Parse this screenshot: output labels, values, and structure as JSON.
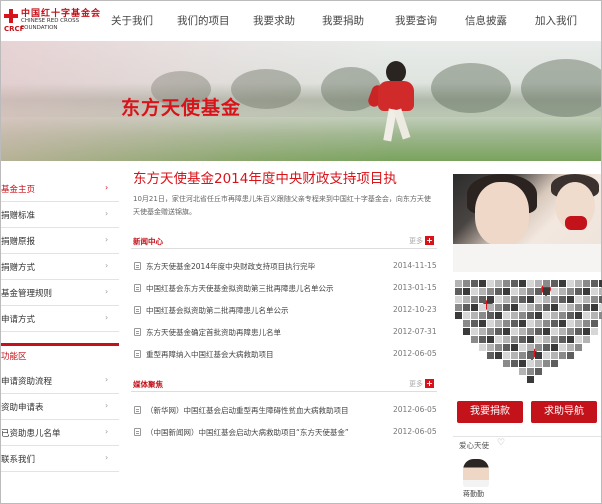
{
  "logo": {
    "cn": "中国红十字基金会",
    "en_line1": "CHINESE RED CROSS",
    "en_line2": "FOUNDATION",
    "abbr": "CRCF"
  },
  "nav": [
    "关于我们",
    "我们的项目",
    "我要求助",
    "我要捐助",
    "我要查询",
    "信息披露",
    "加入我们"
  ],
  "banner": {
    "title": "东方天使基金"
  },
  "sidebar": {
    "items": [
      {
        "label": "基金主页",
        "active": true
      },
      {
        "label": "捐赠标准",
        "active": false
      },
      {
        "label": "捐赠原报",
        "active": false
      },
      {
        "label": "捐赠方式",
        "active": false
      },
      {
        "label": "基金管理规则",
        "active": false
      },
      {
        "label": "申请方式",
        "active": false
      }
    ],
    "section_title": "功能区",
    "section_items": [
      {
        "label": "申请资助流程"
      },
      {
        "label": "资助申请表"
      },
      {
        "label": "已资助患儿名单"
      },
      {
        "label": "联系我们"
      }
    ]
  },
  "main": {
    "headline": "东方天使基金2014年度中央财政支持项目执",
    "summary": "10月21日，家住河北省任丘市再障患儿朱百义跟随父亲专程来到中国红十字基金会，向东方天使天使基金赠送锦旗。",
    "news_section": {
      "title": "新闻中心",
      "more": "更多",
      "items": [
        {
          "text": "东方天使基金2014年度中央财政支持项目执行完毕",
          "date": "2014-11-15"
        },
        {
          "text": "中国红基会东方天使基金拟资助第三批再障患儿名单公示",
          "date": "2013-01-15"
        },
        {
          "text": "中国红基会拟资助第二批再障患儿名单公示",
          "date": "2012-10-23"
        },
        {
          "text": "东方天使基金确定首批资助再障患儿名单",
          "date": "2012-07-31"
        },
        {
          "text": "重型再障纳入中国红基会大病救助项目",
          "date": "2012-06-05"
        }
      ]
    },
    "media_section": {
      "title": "媒体聚焦",
      "more": "更多",
      "items": [
        {
          "text": "（新华网）中国红基会启动重型再生障碍性贫血大病救助项目",
          "date": "2012-06-05"
        },
        {
          "text": "（中国新闻网）中国红基会启动大病救助项目“东方天使基金”",
          "date": "2012-06-05"
        }
      ]
    }
  },
  "right": {
    "donate_button": "我要捐款",
    "help_button": "求助导航",
    "angel_title": "爱心天使",
    "angel_name": "蒋勤勤"
  },
  "colors": {
    "brand_red": "#c4121a",
    "headline_red": "#d8141b"
  }
}
